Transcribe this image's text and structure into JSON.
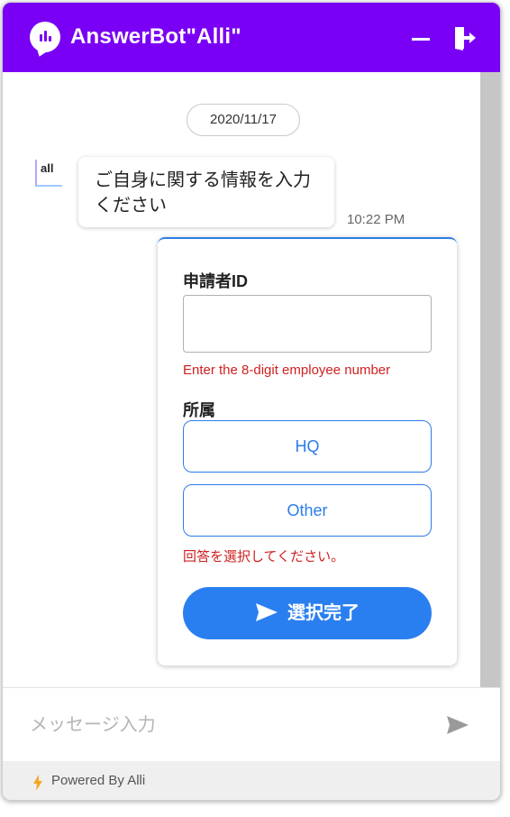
{
  "header": {
    "title": "AnswerBot\"Alli\"",
    "logo_icon": "chat-bubble-logo-icon",
    "minimize_icon": "minimize-icon",
    "exit_icon": "exit-icon",
    "brand_color": "#7a00f5"
  },
  "chat": {
    "date": "2020/11/17",
    "bot_avatar_text": "all",
    "bot_message": "ご自身に関する情報を入力ください",
    "bot_message_time": "10:22 PM"
  },
  "form": {
    "applicant_label": "申請者ID",
    "applicant_value": "",
    "applicant_error": "Enter the 8-digit employee number",
    "affiliation_label": "所属",
    "options": [
      "HQ",
      "Other"
    ],
    "affiliation_error": "回答を選択してください。",
    "submit_label": "選択完了",
    "accent_color": "#2b7de9",
    "error_color": "#d01f1f"
  },
  "composer": {
    "placeholder": "メッセージ入力",
    "send_icon": "send-icon"
  },
  "footer": {
    "powered_by": "Powered By Alli",
    "bolt_icon": "lightning-bolt-icon"
  }
}
